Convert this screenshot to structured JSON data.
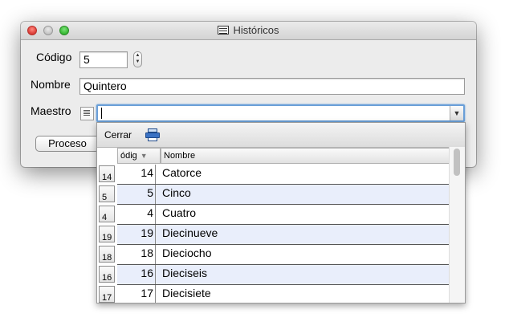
{
  "window": {
    "title": "Históricos"
  },
  "form": {
    "codigo_label": "Código",
    "codigo_value": "5",
    "nombre_label": "Nombre",
    "nombre_value": "Quintero",
    "maestro_label": "Maestro",
    "maestro_value": "",
    "proceso_button": "Proceso"
  },
  "popup": {
    "close_label": "Cerrar",
    "print_icon": "printer-icon",
    "columns": [
      "ódig",
      "Nombre"
    ],
    "sort_indicator": "▼",
    "rows": [
      {
        "rowhdr": "14",
        "code": "14",
        "name": "Catorce"
      },
      {
        "rowhdr": "5",
        "code": "5",
        "name": "Cinco"
      },
      {
        "rowhdr": "4",
        "code": "4",
        "name": "Cuatro"
      },
      {
        "rowhdr": "19",
        "code": "19",
        "name": "Diecinueve"
      },
      {
        "rowhdr": "18",
        "code": "18",
        "name": "Dieciocho"
      },
      {
        "rowhdr": "16",
        "code": "16",
        "name": "Dieciseis"
      },
      {
        "rowhdr": "17",
        "code": "17",
        "name": "Diecisiete"
      }
    ]
  },
  "icons": {
    "stepper": "stepper-arrows-icon",
    "lookup": "lookup-list-icon",
    "combo_arrow": "chevron-down-icon"
  }
}
